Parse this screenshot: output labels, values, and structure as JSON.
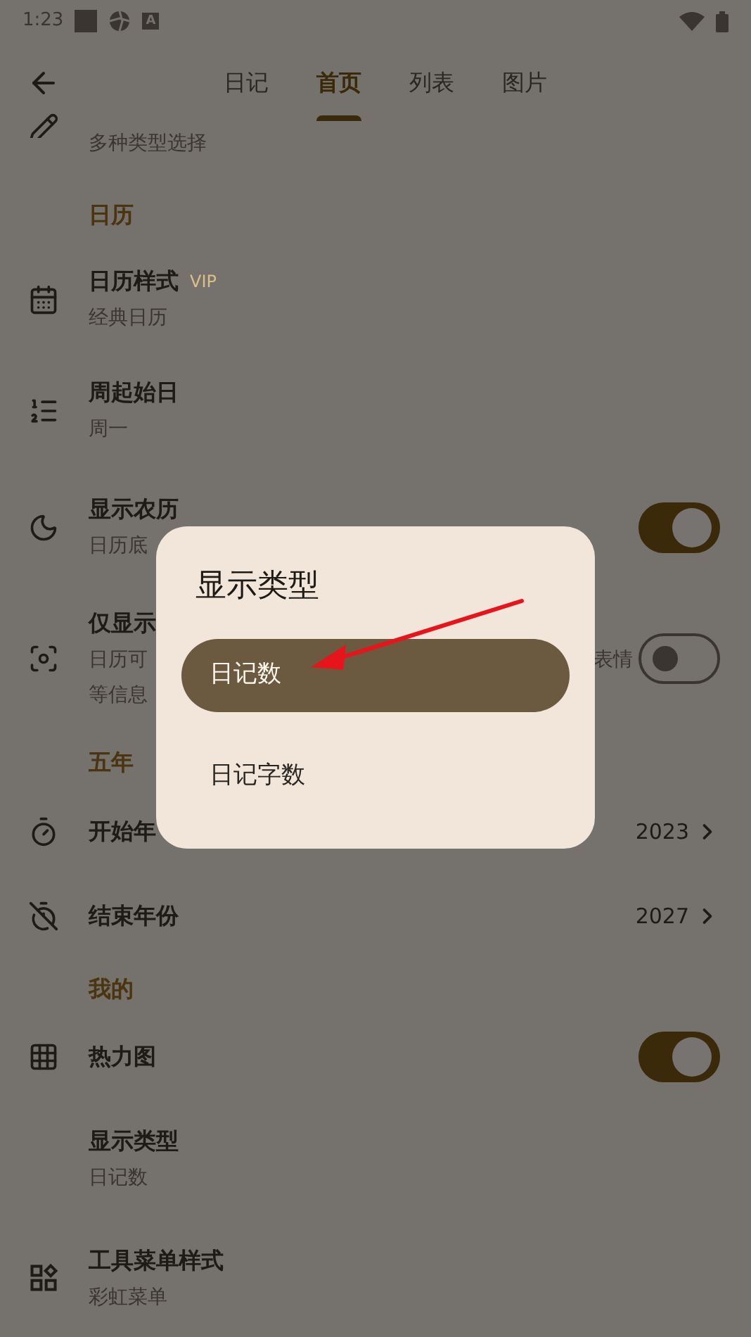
{
  "status_bar": {
    "time": "1:23",
    "notification_letter": "A"
  },
  "tabs": [
    {
      "label": "日记",
      "selected": false
    },
    {
      "label": "首页",
      "selected": true
    },
    {
      "label": "列表",
      "selected": false
    },
    {
      "label": "图片",
      "selected": false
    }
  ],
  "settings": [
    {
      "kind": "partial",
      "subtitle": "多种类型选择"
    },
    {
      "kind": "header",
      "title": "日历"
    },
    {
      "kind": "item",
      "title": "日历样式",
      "badge": "VIP",
      "subtitle": "经典日历"
    },
    {
      "kind": "item",
      "title": "周起始日",
      "subtitle": "周一"
    },
    {
      "kind": "toggle",
      "title": "显示农历",
      "subtitle": "日历底",
      "on": true
    },
    {
      "kind": "toggle",
      "title": "仅显示",
      "subtitle": "日历可",
      "subtitle_end": "表情",
      "subtitle_line_2": "等信息",
      "on": false
    },
    {
      "kind": "header",
      "title": "五年"
    },
    {
      "kind": "value",
      "title": "开始年",
      "value": "2023"
    },
    {
      "kind": "value",
      "title": "结束年份",
      "value": "2027"
    },
    {
      "kind": "header",
      "title": "我的"
    },
    {
      "kind": "toggle",
      "title": "热力图",
      "on": true
    },
    {
      "kind": "item",
      "title": "显示类型",
      "subtitle": "日记数"
    },
    {
      "kind": "item",
      "title": "工具菜单样式",
      "subtitle": "彩虹菜单"
    }
  ],
  "dialog": {
    "title": "显示类型",
    "options": [
      {
        "label": "日记数",
        "selected": true
      },
      {
        "label": "日记字数",
        "selected": false
      }
    ]
  }
}
